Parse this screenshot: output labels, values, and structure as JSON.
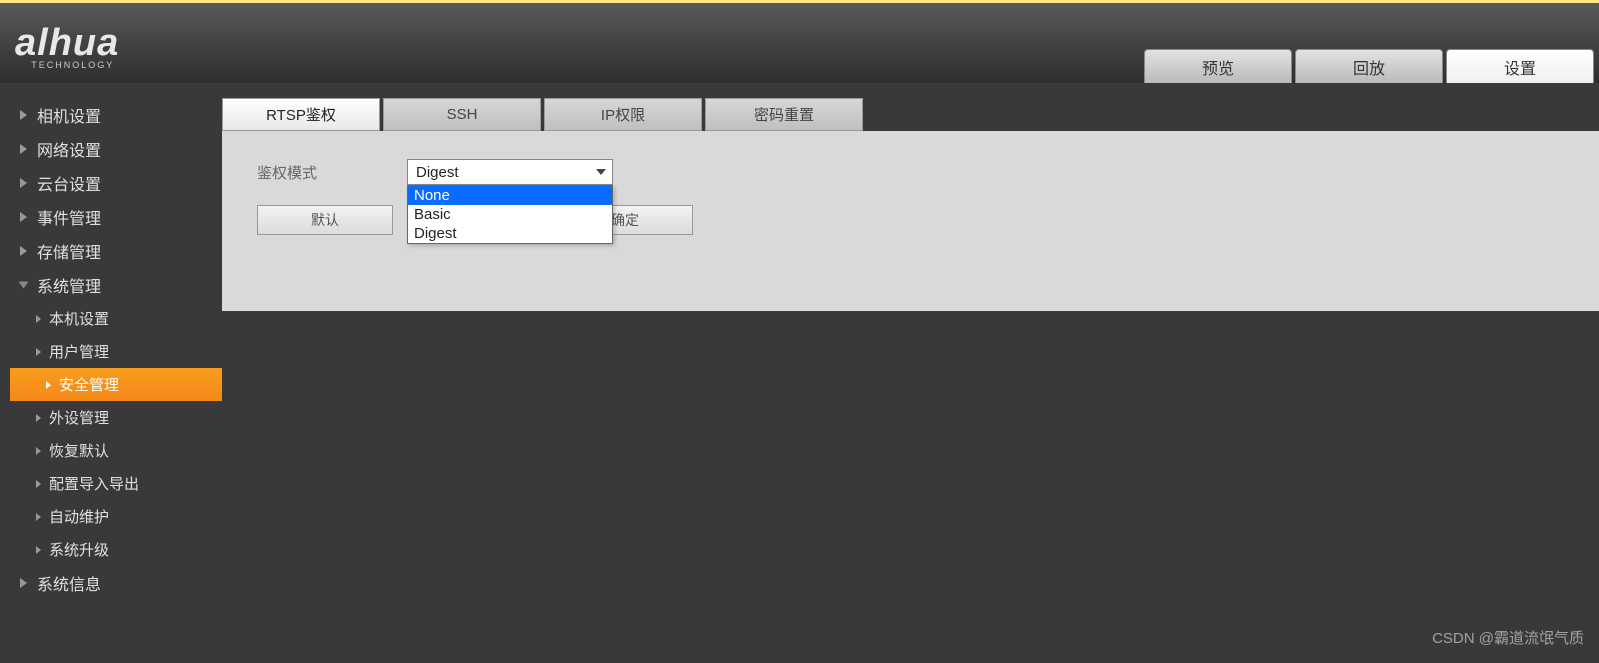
{
  "logo": {
    "brand": "alhua",
    "subtitle": "TECHNOLOGY"
  },
  "nav": {
    "preview": "预览",
    "playback": "回放",
    "settings": "设置"
  },
  "sidebar": {
    "camera": "相机设置",
    "network": "网络设置",
    "ptz": "云台设置",
    "event": "事件管理",
    "storage": "存储管理",
    "system": "系统管理",
    "system_sub": {
      "local": "本机设置",
      "user": "用户管理",
      "security": "安全管理",
      "peripheral": "外设管理",
      "restore": "恢复默认",
      "config": "配置导入导出",
      "auto": "自动维护",
      "upgrade": "系统升级"
    },
    "info": "系统信息"
  },
  "tabs": {
    "rtsp": "RTSP鉴权",
    "ssh": "SSH",
    "iplimit": "IP权限",
    "pwdreset": "密码重置"
  },
  "form": {
    "auth_mode_label": "鉴权模式",
    "selected_value": "Digest",
    "options": {
      "none": "None",
      "basic": "Basic",
      "digest": "Digest"
    },
    "default_btn": "默认",
    "confirm_btn": "确定"
  },
  "watermark": "CSDN @霸道流氓气质"
}
